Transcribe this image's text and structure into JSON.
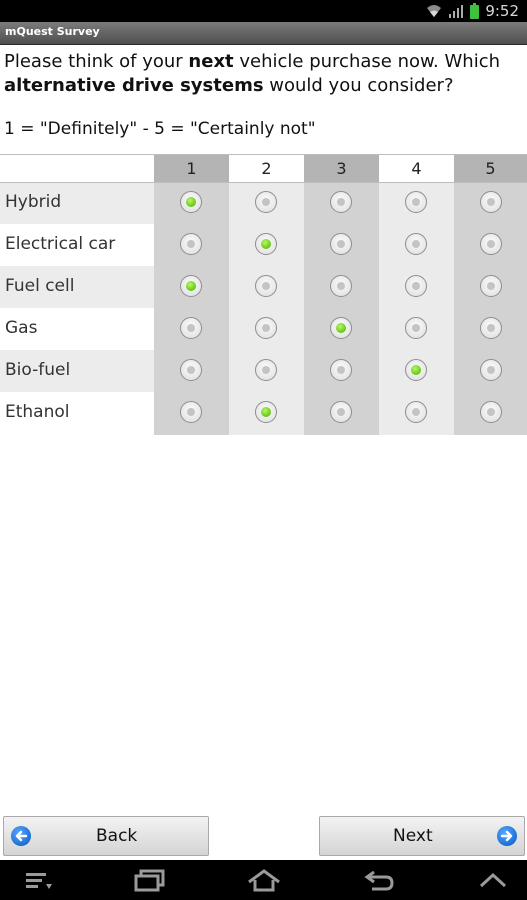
{
  "status": {
    "time": "9:52"
  },
  "app": {
    "title": "mQuest Survey"
  },
  "question": {
    "part1": "Please think of your ",
    "bold1": "next",
    "part2": " vehicle purchase now. Which ",
    "bold2": "alternative drive systems",
    "part3": " would you consider?"
  },
  "scale_note": "1 = \"Definitely\" - 5 = \"Certainly not\"",
  "columns": [
    "1",
    "2",
    "3",
    "4",
    "5"
  ],
  "rows": [
    {
      "label": "Hybrid",
      "selected": 1
    },
    {
      "label": "Electrical car",
      "selected": 2
    },
    {
      "label": "Fuel cell",
      "selected": 1
    },
    {
      "label": "Gas",
      "selected": 3
    },
    {
      "label": "Bio-fuel",
      "selected": 4
    },
    {
      "label": "Ethanol",
      "selected": 2
    }
  ],
  "buttons": {
    "back": "Back",
    "next": "Next"
  },
  "colors": {
    "selected": "#6fcf1c",
    "nav_arrow": "#1b6fd6"
  }
}
